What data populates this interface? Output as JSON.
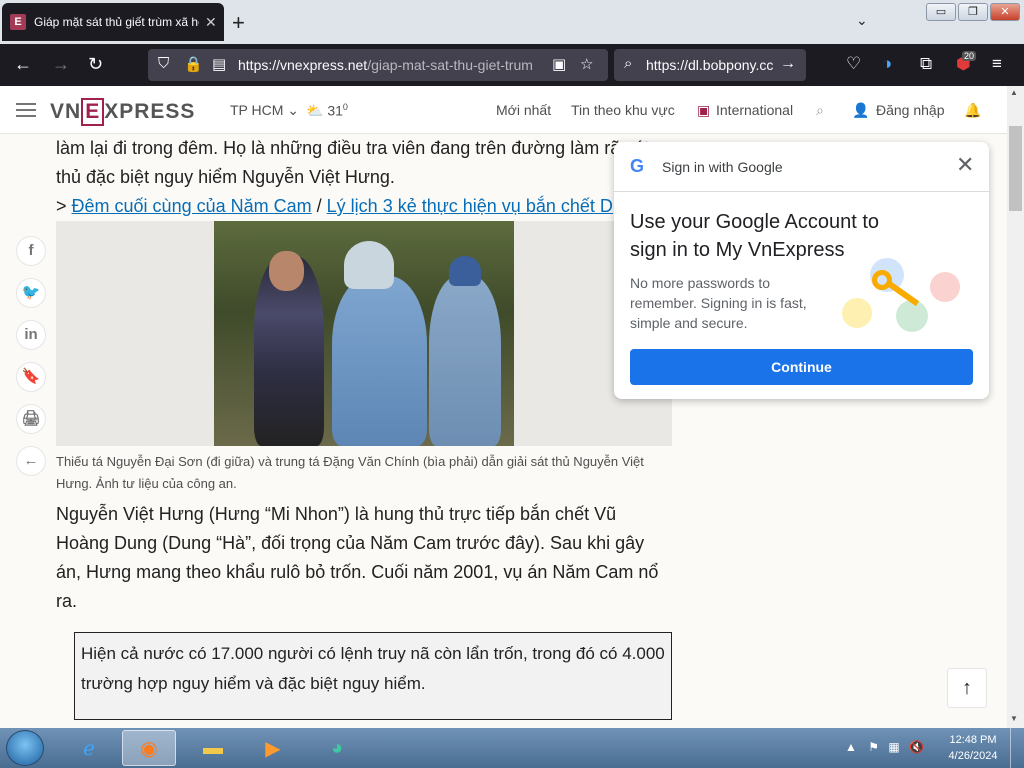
{
  "browser": {
    "tab_title": "Giáp mặt sát thủ giết trùm xã hội",
    "tab_close": "✕",
    "new_tab": "+",
    "url_host": "https://vnexpress.net",
    "url_path": "/giap-mat-sat-thu-giet-trum",
    "search_text": "https://dl.bobpony.cc",
    "extension_badge": "20",
    "window_min": "▭",
    "window_max": "❐",
    "window_close": "✕"
  },
  "site": {
    "logo_e": "E",
    "logo_pre": "VN",
    "logo_rest": "XPRESS",
    "location": "TP HCM",
    "temperature": "31",
    "temp_unit": "0",
    "nav_latest": "Mới nhất",
    "nav_regional": "Tin theo khu vực",
    "nav_international": "International",
    "login": "Đăng nhập"
  },
  "article": {
    "para1_line1": "làm lại đi trong đêm. Họ là những điều tra viên đang trên đường làm rã sát",
    "para1_line2": "thủ đặc biệt nguy hiểm Nguyễn Việt Hưng.",
    "related_prefix": ">",
    "related_link1": "Đêm cuối cùng của Năm Cam",
    "related_sep": "/",
    "related_link2": "Lý lịch 3 kẻ thực hiện vụ bắn chết D",
    "caption": "Thiếu tá Nguyễn Đại Sơn (đi giữa) và trung tá Đặng Văn Chính (bìa phải) dẫn giải sát thủ Nguyễn Việt Hưng. Ảnh tư liệu của công an.",
    "para2": "Nguyễn Việt Hưng (Hưng “Mi Nhon”) là hung thủ trực tiếp bắn chết Vũ Hoàng Dung (Dung “Hà”, đối trọng của Năm Cam trước đây). Sau khi gây án, Hưng mang theo khẩu rulô bỏ trốn. Cuối năm 2001, vụ án Năm Cam nổ ra.",
    "quote": "Hiện cả nước có 17.000 người có lệnh truy nã còn lẩn trốn, trong đó có 4.000 trường hợp nguy hiểm và đặc biệt nguy hiểm."
  },
  "social": [
    "f",
    "🐦",
    "in",
    "🔖",
    "🖨",
    "←"
  ],
  "google_popup": {
    "header": "Sign in with Google",
    "title": "Use your Google Account to sign in to My VnExpress",
    "description": "No more passwords to remember. Signing in is fast, simple and secure.",
    "button": "Continue",
    "close": "✕"
  },
  "scroll_top": "↑",
  "taskbar": {
    "time": "12:48 PM",
    "date": "4/26/2024"
  },
  "colors": {
    "brand": "#9f224e",
    "google_blue": "#1a73e8",
    "link": "#076db6"
  }
}
